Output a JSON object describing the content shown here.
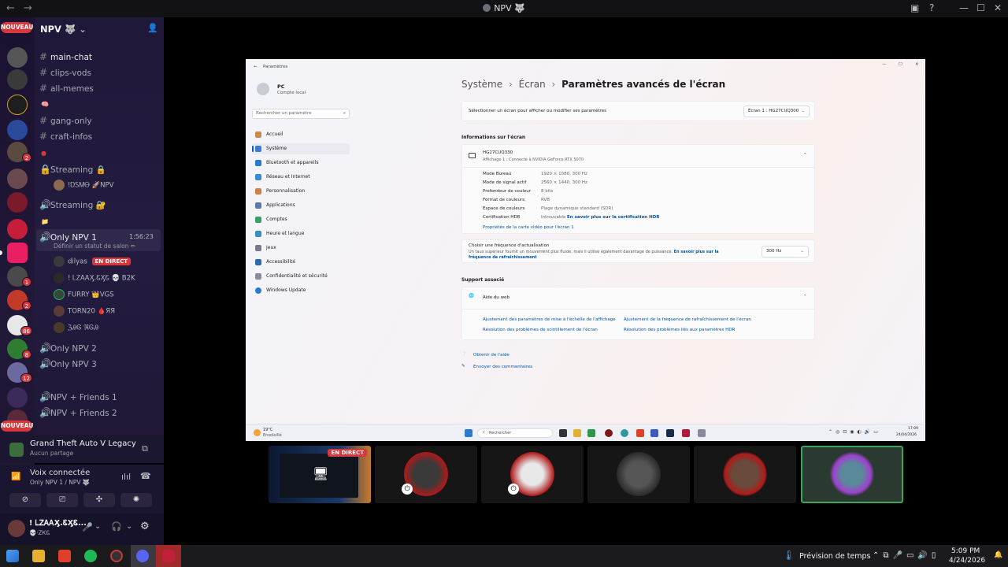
{
  "app": {
    "window_title": "NPV 🐺",
    "nav_back": "←",
    "nav_fwd": "→"
  },
  "rail": {
    "nouveau_label": "NOUVEAU",
    "badges": [
      "2",
      "1",
      "2",
      "86",
      "8",
      "12"
    ]
  },
  "server": {
    "name": "NPV 🐺",
    "channels": [
      {
        "type": "text",
        "name": "main-chat"
      },
      {
        "type": "text",
        "name": "clips-vods"
      },
      {
        "type": "text",
        "name": "all-memes"
      },
      {
        "type": "text",
        "name": "gang-only"
      },
      {
        "type": "text",
        "name": "craft-infos"
      }
    ],
    "voice_channels": [
      {
        "name": "Streaming 🔒"
      },
      {
        "name": "Streaming 🔐"
      },
      {
        "name": "Only NPV 1",
        "timer": "1:56:23",
        "status": "Définir un statut de salon ✏"
      },
      {
        "name": "Only NPV 2"
      },
      {
        "name": "Only NPV 3"
      },
      {
        "name": "NPV + Friends 1"
      },
      {
        "name": "NPV + Friends 2"
      }
    ],
    "streaming_user": "!ᎠᏚᎷᎾ 🚀NPV",
    "voice_users": [
      {
        "name": "dilyas",
        "live": "EN DIRECT"
      },
      {
        "name": "! ᏞᏃᎪᎪӼ.ᏋӼᏋ 💀 B2K",
        "live": ""
      },
      {
        "name": "FURRY 👑VGS",
        "live": ""
      },
      {
        "name": "TORN20 🩸ЯЯ",
        "live": ""
      },
      {
        "name": "ℨᎯᎶ ℜᎶᎯ",
        "live": ""
      }
    ]
  },
  "activity": {
    "game": "Grand Theft Auto V Legacy",
    "game_sub": "Aucun partage",
    "voice_status": "Voix connectée",
    "voice_channel": "Only NPV 1 / NPV 🐺"
  },
  "user": {
    "name": "! ᏞᏃᎪᎪӼ.ᏋӼᏋ...",
    "tag": "💀·ᏃᏦᏋ"
  },
  "settings": {
    "app_title": "Paramètres",
    "account_name": "PC",
    "account_type": "Compte local",
    "search_placeholder": "Rechercher un paramètre",
    "nav": [
      "Accueil",
      "Système",
      "Bluetooth et appareils",
      "Réseau et Internet",
      "Personnalisation",
      "Applications",
      "Comptes",
      "Heure et langue",
      "Jeux",
      "Accessibilité",
      "Confidentialité et sécurité",
      "Windows Update"
    ],
    "breadcrumb_1": "Système",
    "breadcrumb_2": "Écran",
    "breadcrumb_3": "Paramètres avancés de l'écran",
    "select_display_label": "Sélectionner un écran pour afficher ou modifier ses paramètres",
    "select_display_value": "Écran 1 : HG27CUQ300",
    "info_heading": "Informations sur l'écran",
    "monitor_name": "HG27CUQ330",
    "monitor_sub": "Affichage 1 : Connecté à NVIDIA GeForce RTX 5070",
    "rows": [
      {
        "label": "Mode Bureau",
        "value": "1920 × 1080, 300 Hz"
      },
      {
        "label": "Mode de signal actif",
        "value": "2560 × 1440, 300 Hz"
      },
      {
        "label": "Profondeur de couleur",
        "value": "8 bits"
      },
      {
        "label": "Format de couleurs",
        "value": "RVB"
      },
      {
        "label": "Espace de couleurs",
        "value": "Plage dynamique standard (SDR)"
      },
      {
        "label": "Certification HDR",
        "value": "Introuvable"
      }
    ],
    "hdr_link": "En savoir plus sur la certification HDR",
    "adapter_link": "Propriétés de la carte vidéo pour l'écran 1",
    "refresh_title": "Choisir une fréquence d'actualisation",
    "refresh_desc": "Un taux supérieur fournit un mouvement plus fluide, mais il utilise également davantage de puissance.",
    "refresh_link": "En savoir plus sur la fréquence de rafraîchissement",
    "refresh_value": "300 Hz",
    "support_heading": "Support associé",
    "web_help": "Aide du web",
    "help_links": [
      "Ajustement des paramètres de mise à l'échelle de l'affichage",
      "Ajustement de la fréquence de rafraîchissement de l'écran",
      "Résolution des problèmes de scintillement de l'écran",
      "Résolution des problèmes liés aux paramètres HDR"
    ],
    "get_help": "Obtenir de l'aide",
    "feedback": "Envoyer des commentaires",
    "weather_temp": "19°C",
    "weather_desc": "Ensoleillé",
    "search_task": "Rechercher",
    "inner_time": "17:09",
    "inner_date": "24/04/2026"
  },
  "tiles": {
    "live_label": "EN DIRECT"
  },
  "taskbar": {
    "weather": "Prévision de temps",
    "time": "5:09 PM",
    "date": "4/24/2026"
  },
  "colors": {
    "live_red": "#da373c",
    "speaking_green": "#3ba55d",
    "accent_blue": "#005fb8"
  }
}
